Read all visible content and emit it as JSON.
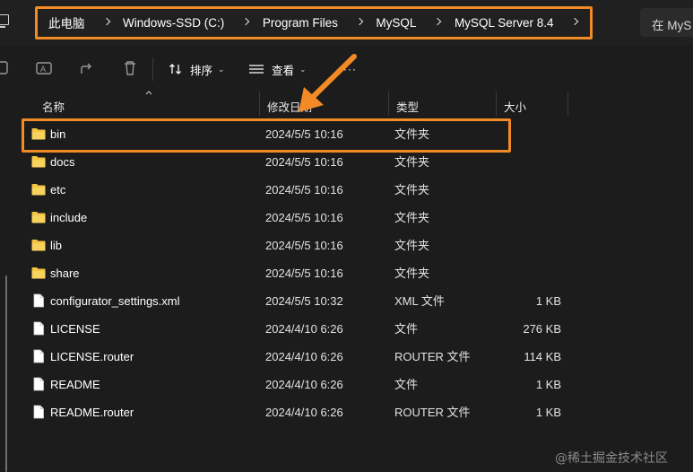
{
  "address_bar": {
    "crumbs": [
      "此电脑",
      "Windows-SSD (C:)",
      "Program Files",
      "MySQL",
      "MySQL Server 8.4"
    ],
    "search_placeholder": "在 MyS"
  },
  "toolbar": {
    "sort_label": "排序",
    "view_label": "查看",
    "more_label": "···",
    "icons": [
      "copy-icon",
      "rename-icon",
      "share-icon",
      "delete-icon",
      "sort-icon",
      "view-icon"
    ]
  },
  "columns": {
    "name": "名称",
    "date": "修改日期",
    "type": "类型",
    "size": "大小"
  },
  "files": [
    {
      "name": "bin",
      "date": "2024/5/5 10:16",
      "type": "文件夹",
      "size": "",
      "kind": "folder"
    },
    {
      "name": "docs",
      "date": "2024/5/5 10:16",
      "type": "文件夹",
      "size": "",
      "kind": "folder"
    },
    {
      "name": "etc",
      "date": "2024/5/5 10:16",
      "type": "文件夹",
      "size": "",
      "kind": "folder"
    },
    {
      "name": "include",
      "date": "2024/5/5 10:16",
      "type": "文件夹",
      "size": "",
      "kind": "folder"
    },
    {
      "name": "lib",
      "date": "2024/5/5 10:16",
      "type": "文件夹",
      "size": "",
      "kind": "folder"
    },
    {
      "name": "share",
      "date": "2024/5/5 10:16",
      "type": "文件夹",
      "size": "",
      "kind": "folder"
    },
    {
      "name": "configurator_settings.xml",
      "date": "2024/5/5 10:32",
      "type": "XML 文件",
      "size": "1 KB",
      "kind": "file"
    },
    {
      "name": "LICENSE",
      "date": "2024/4/10 6:26",
      "type": "文件",
      "size": "276 KB",
      "kind": "file"
    },
    {
      "name": "LICENSE.router",
      "date": "2024/4/10 6:26",
      "type": "ROUTER 文件",
      "size": "114 KB",
      "kind": "file"
    },
    {
      "name": "README",
      "date": "2024/4/10 6:26",
      "type": "文件",
      "size": "1 KB",
      "kind": "file"
    },
    {
      "name": "README.router",
      "date": "2024/4/10 6:26",
      "type": "ROUTER 文件",
      "size": "1 KB",
      "kind": "file"
    }
  ],
  "colors": {
    "highlight": "#f28a26",
    "folder": "#f4c542",
    "background": "#1c1c1c"
  },
  "watermark": "@稀土掘金技术社区"
}
